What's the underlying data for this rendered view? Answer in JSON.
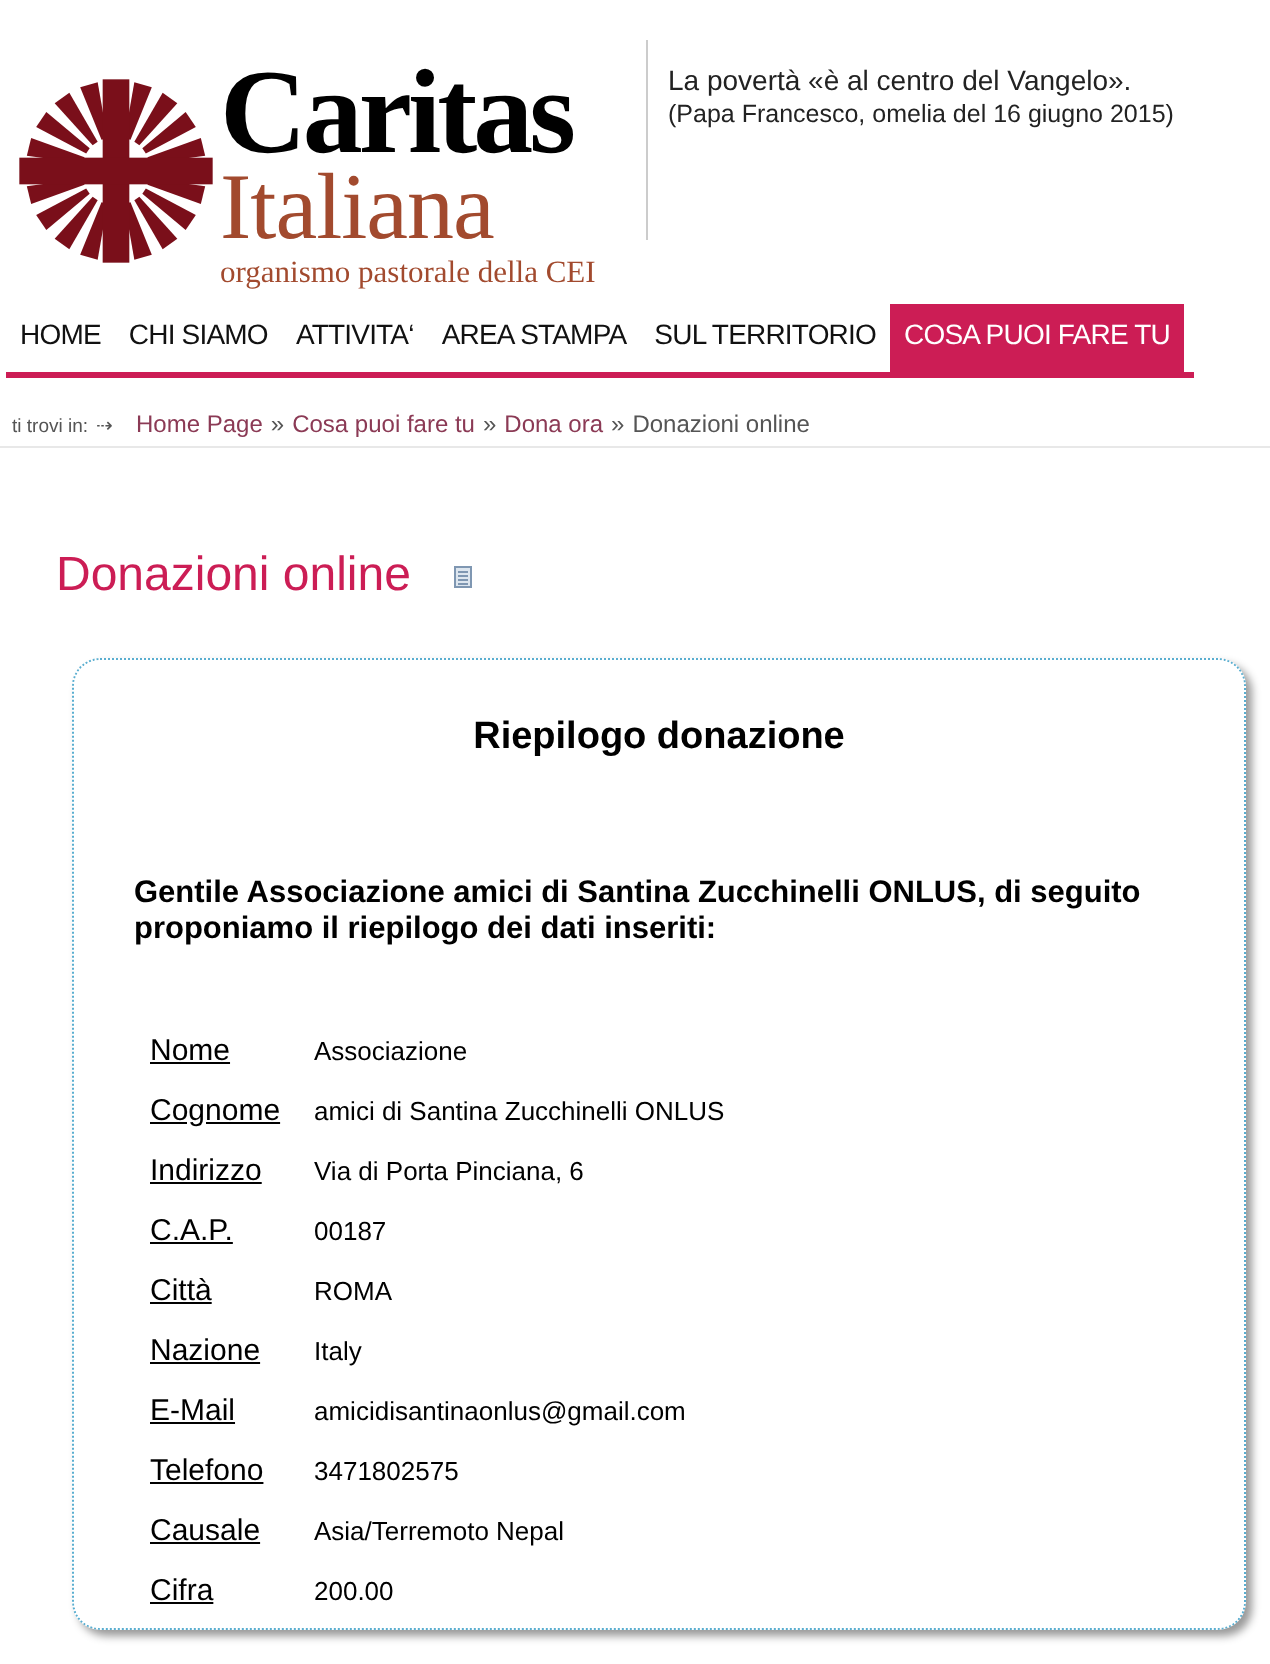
{
  "logo": {
    "name": "Caritas",
    "subname": "Italiana",
    "tagline": "organismo pastorale della CEI"
  },
  "quote": {
    "text": "La povertà «è al centro del Vangelo».",
    "source": "(Papa Francesco, omelia del 16 giugno 2015)"
  },
  "nav": [
    {
      "label": "HOME",
      "selected": false
    },
    {
      "label": "CHI SIAMO",
      "selected": false
    },
    {
      "label": "ATTIVITA‘",
      "selected": false
    },
    {
      "label": "AREA STAMPA",
      "selected": false
    },
    {
      "label": "SUL TERRITORIO",
      "selected": false
    },
    {
      "label": "COSA PUOI FARE TU",
      "selected": true
    }
  ],
  "breadcrumb": {
    "prefix": "ti trovi in:",
    "arrow": "⇢",
    "items": [
      {
        "label": "Home Page",
        "kind": "link"
      },
      {
        "label": "Cosa puoi fare tu",
        "kind": "link"
      },
      {
        "label": "Dona ora",
        "kind": "link"
      },
      {
        "label": "Donazioni online",
        "kind": "current"
      }
    ],
    "separator": "»"
  },
  "page_title": "Donazioni online",
  "summary": {
    "title": "Riepilogo donazione",
    "intro": "Gentile Associazione amici di Santina Zucchinelli ONLUS, di seguito proponiamo il riepilogo dei dati inseriti:",
    "rows": [
      {
        "label": "Nome",
        "value": "Associazione"
      },
      {
        "label": "Cognome",
        "value": "amici di Santina Zucchinelli ONLUS"
      },
      {
        "label": "Indirizzo",
        "value": "Via di Porta Pinciana, 6"
      },
      {
        "label": "C.A.P.",
        "value": "00187"
      },
      {
        "label": "Città",
        "value": "ROMA"
      },
      {
        "label": "Nazione",
        "value": "Italy"
      },
      {
        "label": "E-Mail",
        "value": "amicidisantinaonlus@gmail.com"
      },
      {
        "label": "Telefono",
        "value": "3471802575"
      },
      {
        "label": "Causale",
        "value": "Asia/Terremoto Nepal"
      },
      {
        "label": "Cifra",
        "value": "200.00"
      }
    ]
  }
}
